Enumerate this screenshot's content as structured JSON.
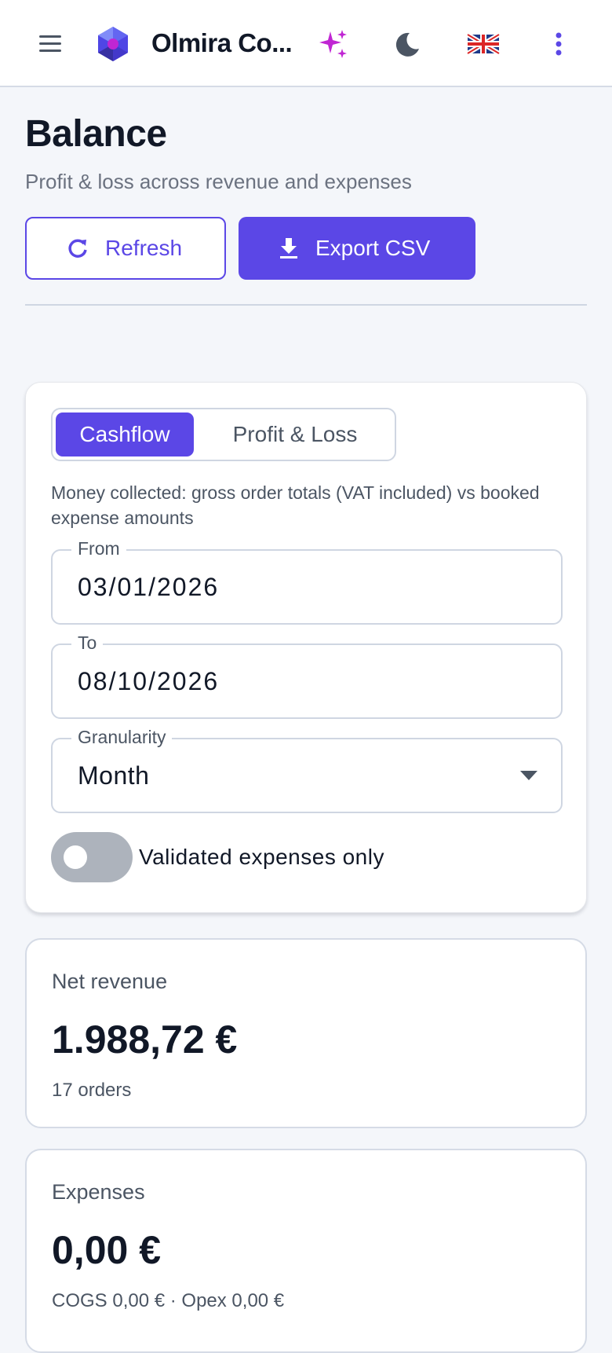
{
  "app": {
    "title": "Olmira Co...",
    "icons": [
      "menu-icon",
      "app-logo-icon",
      "sparkle-icon",
      "dark-mode-icon",
      "uk-flag-icon",
      "more-vert-icon"
    ],
    "colors": {
      "primary": "#5b47e6",
      "background": "#f4f6fa",
      "sparkle": "#c026d3"
    }
  },
  "page": {
    "title": "Balance",
    "subtitle": "Profit & loss across revenue and expenses",
    "refresh_label": "Refresh",
    "export_label": "Export CSV"
  },
  "filters": {
    "tabs": [
      {
        "label": "Cashflow",
        "active": true
      },
      {
        "label": "Profit & Loss",
        "active": false
      }
    ],
    "description": "Money collected: gross order totals (VAT included) vs booked expense amounts",
    "from_label": "From",
    "from_value": "03/01/2026",
    "to_label": "To",
    "to_value": "08/10/2026",
    "granularity_label": "Granularity",
    "granularity_value": "Month",
    "validated_only_label": "Validated expenses only",
    "validated_only": false
  },
  "stats": [
    {
      "label": "Net revenue",
      "value": "1.988,72 €",
      "sub": "17 orders"
    },
    {
      "label": "Expenses",
      "value": "0,00 €",
      "sub": "COGS 0,00 € · Opex 0,00 €"
    }
  ]
}
